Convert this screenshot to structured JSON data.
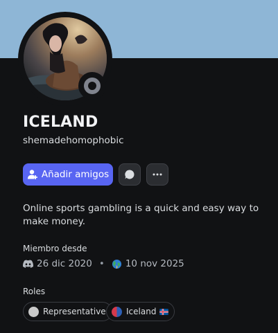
{
  "profile": {
    "display_name": "ICELAND",
    "username": "shemadehomophobic",
    "status": "offline",
    "banner_color": "#8eb6d6",
    "bio": "Online sports gambling is a quick and easy way to make money."
  },
  "actions": {
    "add_friend_label": "Añadir amigos",
    "message_icon": "speech-bubble-icon",
    "more_icon": "ellipsis-icon",
    "accent_color": "#5865f2"
  },
  "member_since": {
    "label": "Miembro desde",
    "discord_date": "26 dic 2020",
    "server_date": "10 nov 2025"
  },
  "roles": {
    "label": "Roles",
    "items": [
      {
        "name": "Representative",
        "color": "#c9c9c9"
      },
      {
        "name": "Iceland",
        "color": "#d5394b",
        "flag": "iceland-flag-icon"
      }
    ]
  }
}
